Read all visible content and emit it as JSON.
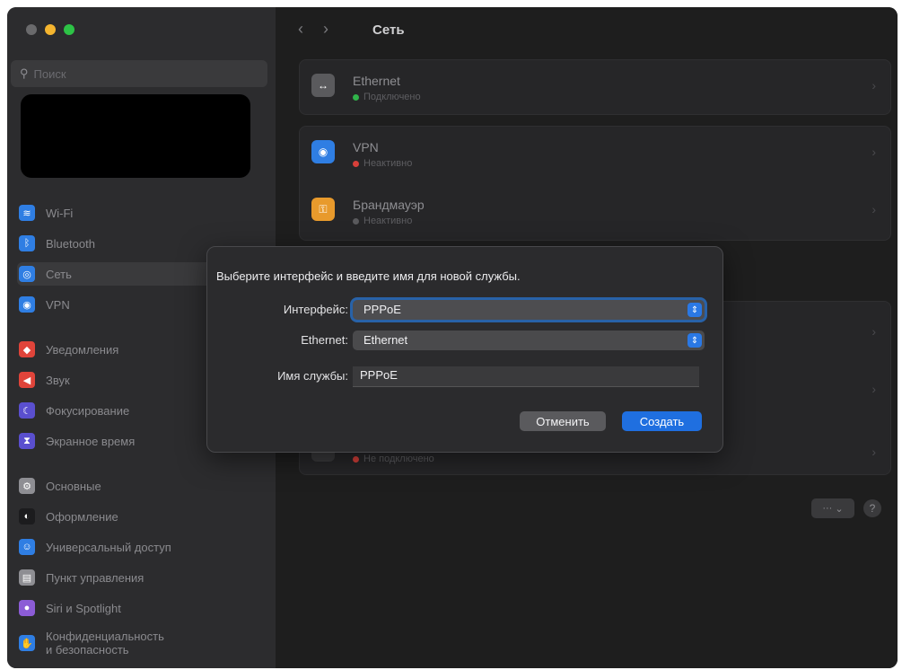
{
  "sidebar": {
    "search_placeholder": "Поиск",
    "items": [
      {
        "label": "Wi-Fi",
        "icon": "wifi-icon",
        "color": "#2f7ee3"
      },
      {
        "label": "Bluetooth",
        "icon": "bluetooth-icon",
        "color": "#2f7ee3"
      },
      {
        "label": "Сеть",
        "icon": "globe-icon",
        "color": "#2f7ee3",
        "selected": true
      },
      {
        "label": "VPN",
        "icon": "vpn-globe-icon",
        "color": "#2f7ee3"
      },
      {
        "label": "Уведомления",
        "icon": "bell-icon",
        "color": "#e0443a"
      },
      {
        "label": "Звук",
        "icon": "speaker-icon",
        "color": "#e0443a"
      },
      {
        "label": "Фокусирование",
        "icon": "moon-icon",
        "color": "#5a4fcf"
      },
      {
        "label": "Экранное время",
        "icon": "hourglass-icon",
        "color": "#5a4fcf"
      },
      {
        "label": "Основные",
        "icon": "gear-icon",
        "color": "#8e8e93"
      },
      {
        "label": "Оформление",
        "icon": "appearance-icon",
        "color": "#1c1c1e"
      },
      {
        "label": "Универсальный доступ",
        "icon": "accessibility-icon",
        "color": "#2f7ee3"
      },
      {
        "label": "Пункт управления",
        "icon": "control-center-icon",
        "color": "#8e8e93"
      },
      {
        "label": "Siri и Spotlight",
        "icon": "siri-icon",
        "color": "#8c5cd6"
      },
      {
        "label": "Конфиденциальность",
        "label2": "и безопасность",
        "icon": "hand-icon",
        "color": "#2f7ee3"
      }
    ]
  },
  "main": {
    "title": "Сеть",
    "services": [
      {
        "title": "Ethernet",
        "status": "Подключено",
        "status_color": "#30b34a",
        "icon": "ethernet-icon",
        "icon_color": "#5a5a5d"
      },
      {
        "title": "VPN",
        "status": "Неактивно",
        "status_color": "#d8403a",
        "icon": "vpn-globe-icon",
        "icon_color": "#2f7ee3"
      },
      {
        "title": "Брандмауэр",
        "status": "Неактивно",
        "status_color": "#5a5a5d",
        "icon": "firewall-icon",
        "icon_color": "#e89a2c"
      },
      {
        "title": "",
        "status": "Не подключено",
        "status_color": "#d8403a",
        "icon": "service-icon",
        "icon_color": "#3a3a3c"
      }
    ],
    "more_label": "···",
    "help_label": "?"
  },
  "dialog": {
    "title": "Выберите интерфейс и введите имя для новой службы.",
    "interface_label": "Интерфейс:",
    "interface_value": "PPPoE",
    "ethernet_label": "Ethernet:",
    "ethernet_value": "Ethernet",
    "service_name_label": "Имя службы:",
    "service_name_value": "PPPoE",
    "cancel_label": "Отменить",
    "create_label": "Создать",
    "accent_color": "#1f6fe0"
  }
}
